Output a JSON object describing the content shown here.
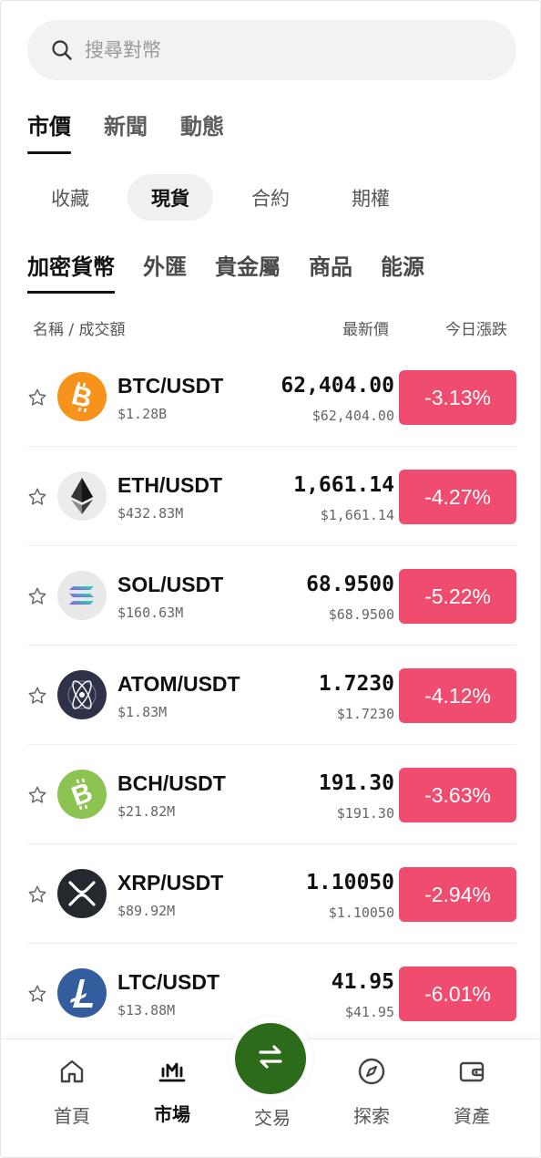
{
  "search": {
    "placeholder": "搜尋對幣"
  },
  "main_tabs": [
    {
      "label": "市價"
    },
    {
      "label": "新聞"
    },
    {
      "label": "動態"
    }
  ],
  "sub_tabs": [
    {
      "label": "收藏"
    },
    {
      "label": "現貨"
    },
    {
      "label": "合約"
    },
    {
      "label": "期權"
    }
  ],
  "category_tabs": [
    {
      "label": "加密貨幣"
    },
    {
      "label": "外匯"
    },
    {
      "label": "貴金屬"
    },
    {
      "label": "商品"
    },
    {
      "label": "能源"
    }
  ],
  "columns": {
    "name": "名稱 / 成交額",
    "price": "最新價",
    "change": "今日漲跌"
  },
  "rows": [
    {
      "pair": "BTC/USDT",
      "volume": "$1.28B",
      "price": "62,404.00",
      "price_usd": "$62,404.00",
      "change": "-3.13%",
      "icon": "bitcoin-icon"
    },
    {
      "pair": "ETH/USDT",
      "volume": "$432.83M",
      "price": "1,661.14",
      "price_usd": "$1,661.14",
      "change": "-4.27%",
      "icon": "ethereum-icon"
    },
    {
      "pair": "SOL/USDT",
      "volume": "$160.63M",
      "price": "68.9500",
      "price_usd": "$68.9500",
      "change": "-5.22%",
      "icon": "solana-icon"
    },
    {
      "pair": "ATOM/USDT",
      "volume": "$1.83M",
      "price": "1.7230",
      "price_usd": "$1.7230",
      "change": "-4.12%",
      "icon": "cosmos-icon"
    },
    {
      "pair": "BCH/USDT",
      "volume": "$21.82M",
      "price": "191.30",
      "price_usd": "$191.30",
      "change": "-3.63%",
      "icon": "bitcoin-cash-icon"
    },
    {
      "pair": "XRP/USDT",
      "volume": "$89.92M",
      "price": "1.10050",
      "price_usd": "$1.10050",
      "change": "-2.94%",
      "icon": "xrp-icon"
    },
    {
      "pair": "LTC/USDT",
      "volume": "$13.88M",
      "price": "41.95",
      "price_usd": "$41.95",
      "change": "-6.01%",
      "icon": "litecoin-icon"
    }
  ],
  "bottom_nav": [
    {
      "label": "首頁",
      "icon": "home-icon"
    },
    {
      "label": "市場",
      "icon": "market-chart-icon"
    },
    {
      "label": "交易",
      "icon": "swap-arrows-icon"
    },
    {
      "label": "探索",
      "icon": "compass-icon"
    },
    {
      "label": "資產",
      "icon": "wallet-icon"
    }
  ],
  "colors": {
    "negative_change": "#ef4c6f",
    "trade_button": "#2b6b1a"
  }
}
